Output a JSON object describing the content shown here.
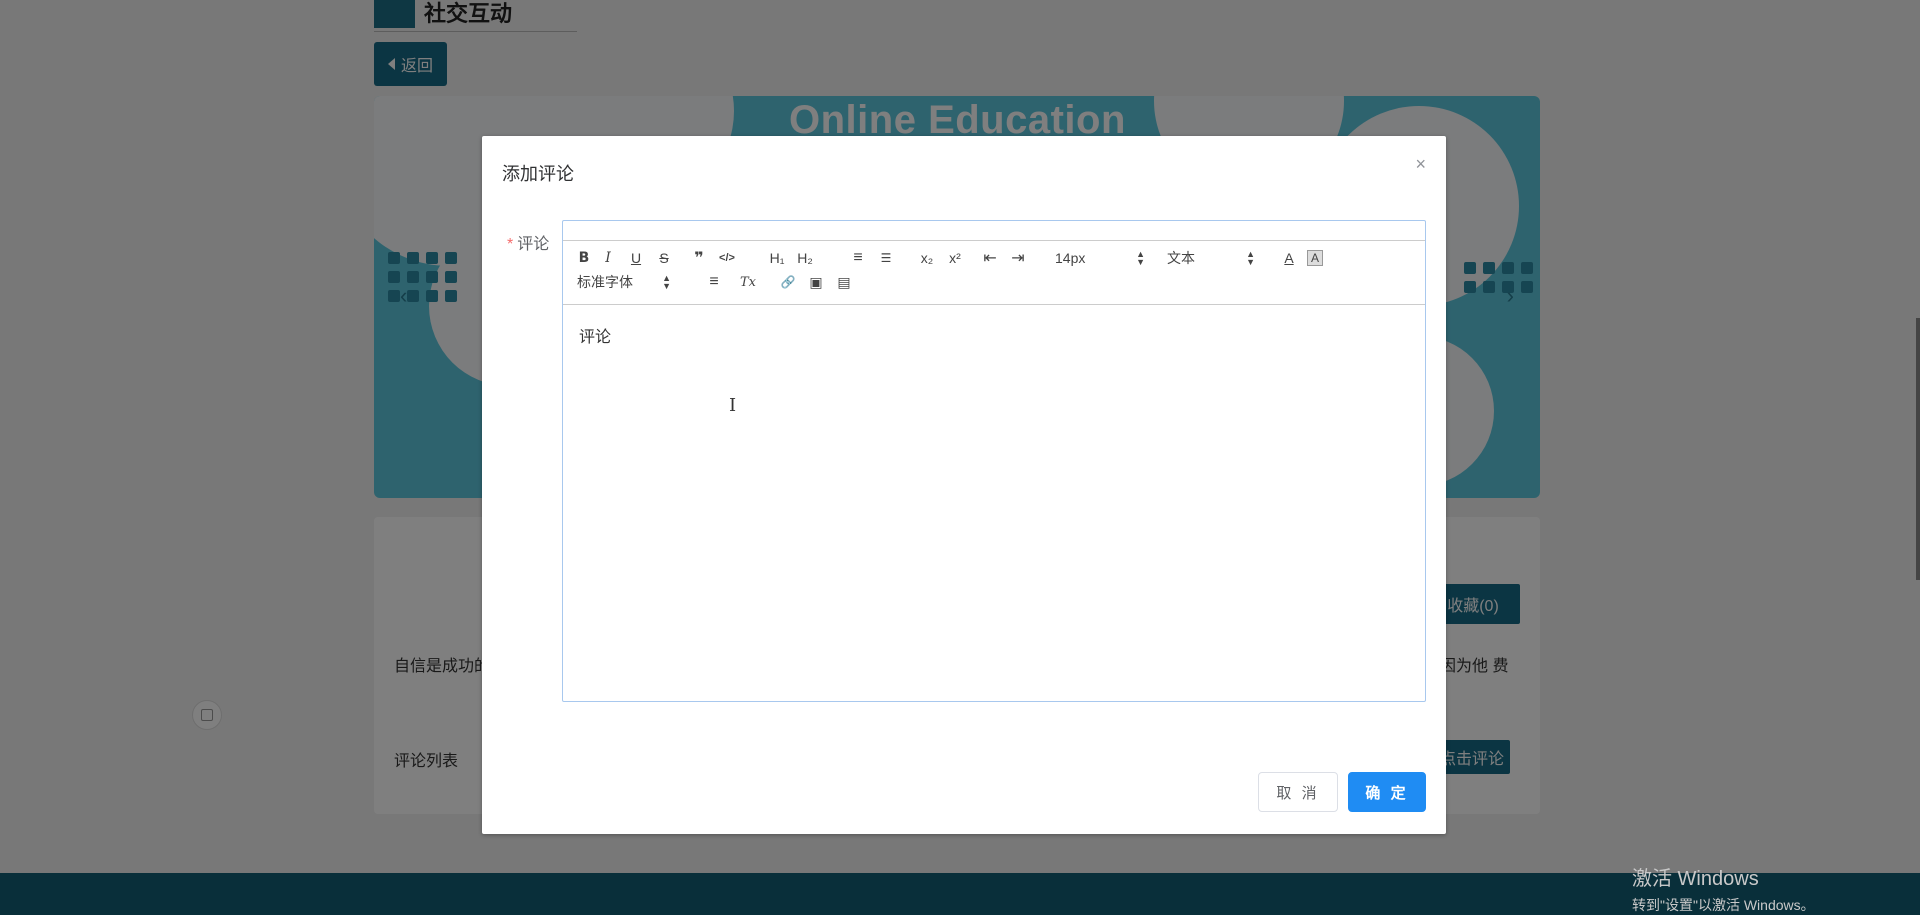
{
  "page": {
    "title": "社交互动",
    "back_label": "返回",
    "banner_headline": "Online Education",
    "collect_label": "收藏(0)",
    "desc_left": "自信是成功的 们都有着巨大",
    "desc_right": "是因为他 费",
    "comment_list_label": "评论列表",
    "comment_button": "点击评论"
  },
  "dialog": {
    "title": "添加评论",
    "close_glyph": "×",
    "field_required_mark": "*",
    "field_label": "评论",
    "editor_content": "评论",
    "cancel_label": "取 消",
    "confirm_label": "确 定"
  },
  "toolbar": {
    "row1": [
      {
        "name": "bold",
        "glyph": "B"
      },
      {
        "name": "italic",
        "glyph": "I"
      },
      {
        "name": "underline",
        "glyph": "U"
      },
      {
        "name": "strike",
        "glyph": "S"
      },
      {
        "name": "blockquote",
        "glyph": "❞"
      },
      {
        "name": "code-block",
        "glyph": "</>"
      },
      {
        "name": "h1",
        "glyph": "H₁"
      },
      {
        "name": "h2",
        "glyph": "H₂"
      },
      {
        "name": "ordered-list",
        "glyph": "≡"
      },
      {
        "name": "bullet-list",
        "glyph": "☰"
      },
      {
        "name": "subscript",
        "glyph": "x₂"
      },
      {
        "name": "superscript",
        "glyph": "x²"
      },
      {
        "name": "outdent",
        "glyph": "⇤"
      },
      {
        "name": "indent",
        "glyph": "⇥"
      },
      {
        "name": "color",
        "glyph": "A"
      },
      {
        "name": "background",
        "glyph": "A"
      }
    ],
    "size_select": "14px",
    "header_select": "文本",
    "font_select": "标准字体",
    "row2": [
      {
        "name": "align",
        "glyph": "≡"
      },
      {
        "name": "clean",
        "glyph": "Tx"
      },
      {
        "name": "link",
        "glyph": "🔗"
      },
      {
        "name": "image",
        "glyph": "▣"
      },
      {
        "name": "video",
        "glyph": "▤"
      }
    ]
  },
  "watermark": {
    "line1": "激活 Windows",
    "line2": "转到\"设置\"以激活 Windows。"
  }
}
